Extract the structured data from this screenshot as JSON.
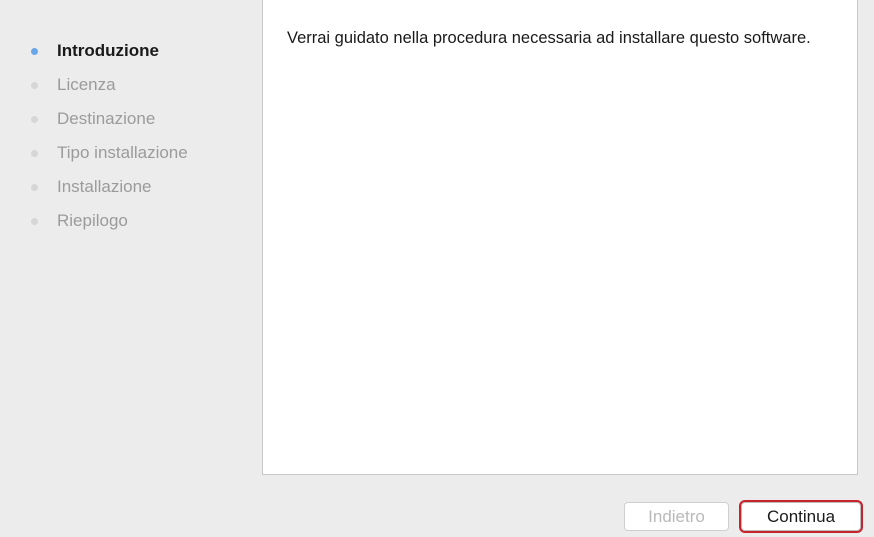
{
  "sidebar": {
    "steps": [
      {
        "label": "Introduzione",
        "state": "current"
      },
      {
        "label": "Licenza",
        "state": "pending"
      },
      {
        "label": "Destinazione",
        "state": "pending"
      },
      {
        "label": "Tipo installazione",
        "state": "pending"
      },
      {
        "label": "Installazione",
        "state": "pending"
      },
      {
        "label": "Riepilogo",
        "state": "pending"
      }
    ]
  },
  "content": {
    "text": "Verrai guidato nella procedura necessaria ad installare questo software."
  },
  "footer": {
    "back_label": "Indietro",
    "back_enabled": false,
    "continue_label": "Continua"
  },
  "colors": {
    "window_bg": "#ececec",
    "content_bg": "#ffffff",
    "active_dot": "#6aa7e8",
    "inactive_dot": "#d6d6d6",
    "highlight_outline": "#c8232c"
  }
}
